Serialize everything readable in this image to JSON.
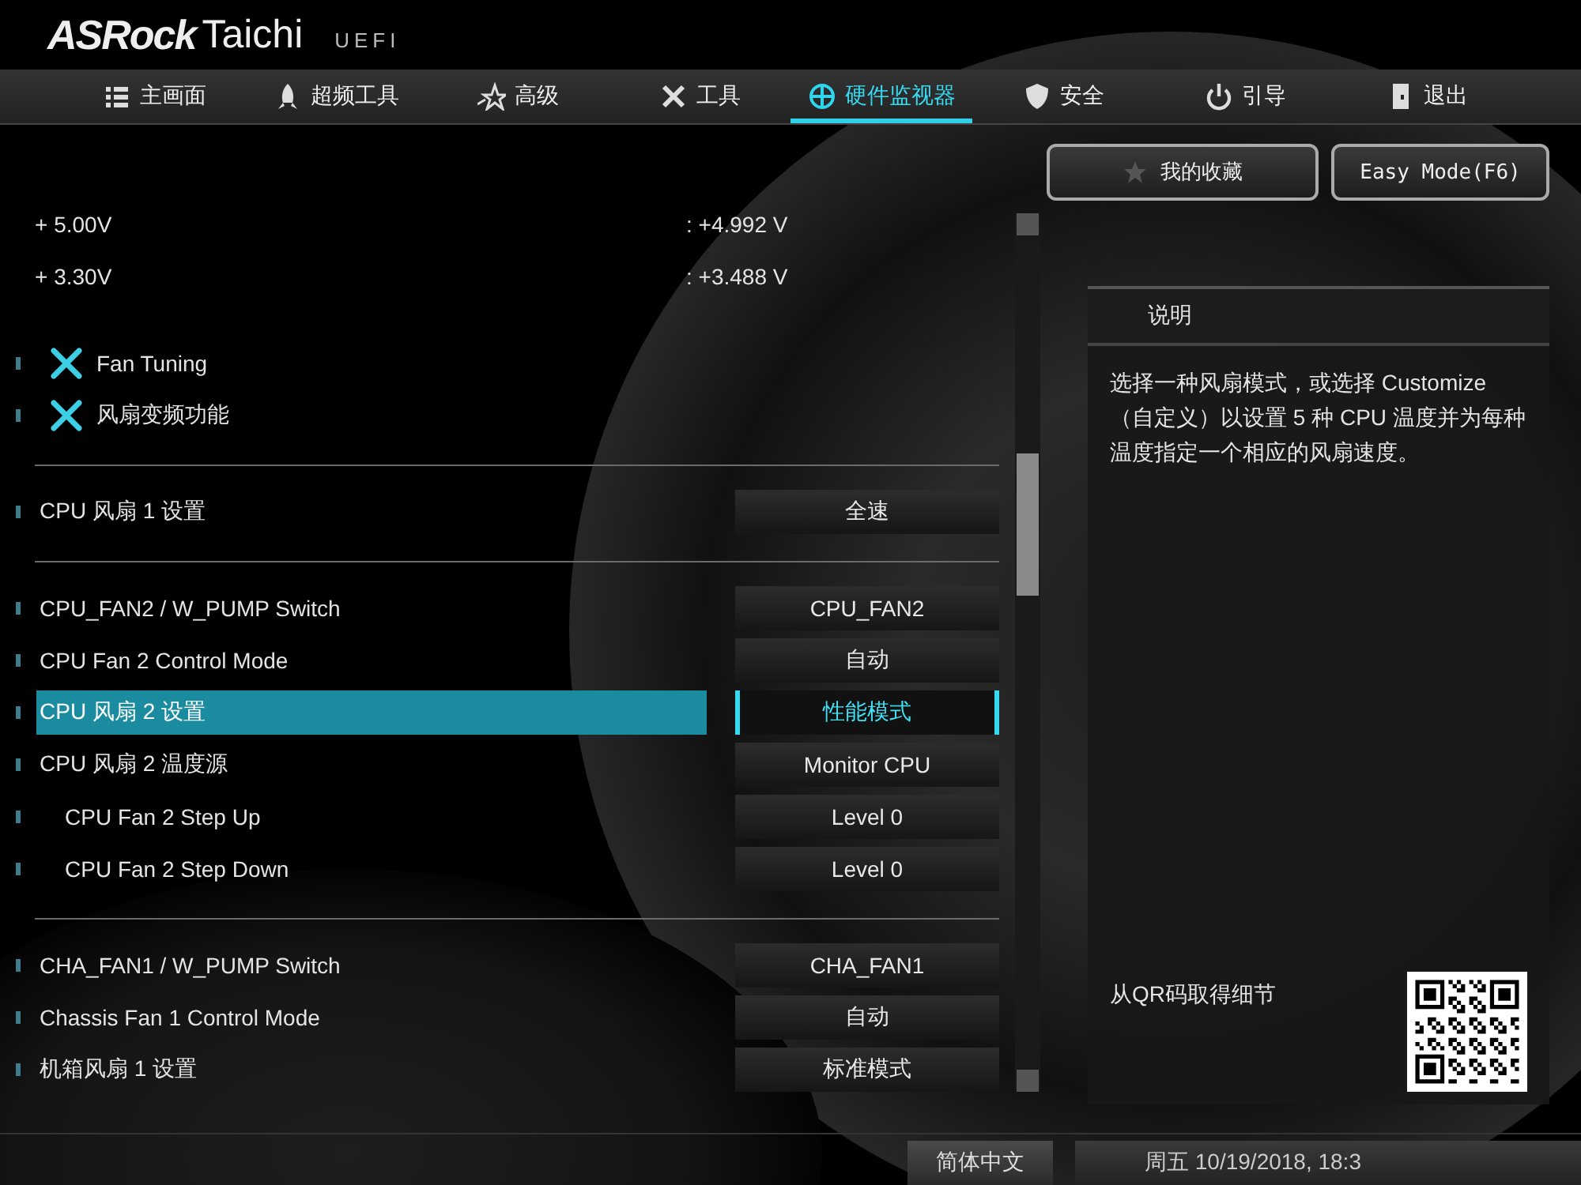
{
  "logo": {
    "brand": "ASRock",
    "model": "Taichi",
    "suffix": "UEFI"
  },
  "tabs": [
    {
      "label": "主画面",
      "selected": false
    },
    {
      "label": "超频工具",
      "selected": false
    },
    {
      "label": "高级",
      "selected": false
    },
    {
      "label": "工具",
      "selected": false
    },
    {
      "label": "硬件监视器",
      "selected": true
    },
    {
      "label": "安全",
      "selected": false
    },
    {
      "label": "引导",
      "selected": false
    },
    {
      "label": "退出",
      "selected": false
    }
  ],
  "top_buttons": {
    "favorites": "我的收藏",
    "easy_mode": "Easy Mode(F6)"
  },
  "items": [
    {
      "kind": "voltage",
      "label": "+ 5.00V",
      "value": ": +4.992 V"
    },
    {
      "kind": "voltage",
      "label": "+ 3.30V",
      "value": ": +3.488 V"
    },
    {
      "kind": "link",
      "label": "Fan Tuning"
    },
    {
      "kind": "link",
      "label": "风扇变频功能"
    },
    {
      "kind": "divider"
    },
    {
      "kind": "setting",
      "label": "CPU 风扇 1 设置",
      "value": "全速",
      "selected": false
    },
    {
      "kind": "divider"
    },
    {
      "kind": "setting",
      "label": "CPU_FAN2 / W_PUMP Switch",
      "value": "CPU_FAN2",
      "selected": false
    },
    {
      "kind": "setting",
      "label": "CPU Fan 2 Control Mode",
      "value": "自动",
      "selected": false
    },
    {
      "kind": "setting",
      "label": "CPU 风扇 2 设置",
      "value": "性能模式",
      "selected": true
    },
    {
      "kind": "setting",
      "label": "CPU 风扇 2 温度源",
      "value": "Monitor CPU",
      "selected": false,
      "children": [
        {
          "kind": "setting",
          "label": "CPU Fan 2 Step Up",
          "value": "Level 0",
          "selected": false
        },
        {
          "kind": "setting",
          "label": "CPU Fan 2 Step Down",
          "value": "Level 0",
          "selected": false
        }
      ]
    },
    {
      "kind": "divider"
    },
    {
      "kind": "setting",
      "label": "CHA_FAN1 / W_PUMP Switch",
      "value": "CHA_FAN1",
      "selected": false
    },
    {
      "kind": "setting",
      "label": "Chassis Fan 1 Control Mode",
      "value": "自动",
      "selected": false
    },
    {
      "kind": "setting",
      "label": "机箱风扇 1 设置",
      "value": "标准模式",
      "selected": false
    }
  ],
  "help_panel": {
    "title": "说明",
    "text": "选择一种风扇模式，或选择 Customize（自定义）以设置 5 种 CPU 温度并为每种温度指定一个相应的风扇速度。",
    "qr_label": "从QR码取得细节"
  },
  "status_bar": {
    "language": "简体中文",
    "datetime": "周五 10/19/2018, 18:3"
  }
}
